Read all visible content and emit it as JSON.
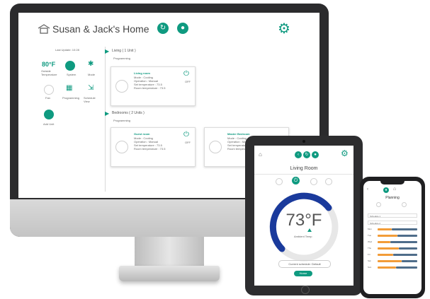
{
  "colors": {
    "accent": "#0f9a80",
    "ring": "#1a3a9c",
    "orange": "#f29c38",
    "slate": "#4f6d8a"
  },
  "desktop": {
    "title": "Susan & Jack's Home",
    "last_update": "Last Update: 10:28",
    "temp": "80°F",
    "temp_label": "Outside Temperature",
    "quick": [
      "System",
      "Mode",
      "Fan",
      "Programming",
      "Schedule View"
    ],
    "add_label": "Add Unit",
    "groups": [
      {
        "title": "Living ( 1 Unit )",
        "program": "Programming",
        "units": [
          {
            "name": "Living room",
            "lines": [
              "Mode : Cooling",
              "Operation : Manual",
              "Set temperature : 73.5",
              "Room temperature : 73.5"
            ],
            "power": "OFF"
          }
        ]
      },
      {
        "title": "Bedrooms ( 2 Units )",
        "program": "Programming",
        "units": [
          {
            "name": "Guest room",
            "lines": [
              "Mode : Cooling",
              "Operation : Manual",
              "Set temperature : 73.5",
              "Room temperature : 73.5"
            ],
            "power": "OFF"
          },
          {
            "name": "Master Bedroom",
            "lines": [
              "Mode : Cooling",
              "Operation : Manual",
              "Set temperature",
              "Room temperature"
            ],
            "power": "OFF"
          }
        ]
      }
    ]
  },
  "tablet": {
    "room": "Living Room",
    "temp": "73°F",
    "temp_sub": "Ambient Temp",
    "mode_labels": [
      "COOL",
      "POWER",
      "FAN",
      "SCHEDULE"
    ],
    "schedule_btn": "Current schedule: Default",
    "home_btn": "Home"
  },
  "phone": {
    "title": "Planning",
    "rows": [
      "Schedule 1",
      "Schedule 2"
    ],
    "days": [
      "Mon",
      "Tue",
      "Wed",
      "Thu",
      "Fri",
      "Sat",
      "Sun"
    ],
    "day_labels": [
      "Mon",
      "Tue",
      "Wed",
      "Thu",
      "Fri",
      "Sat",
      "Sun"
    ]
  }
}
